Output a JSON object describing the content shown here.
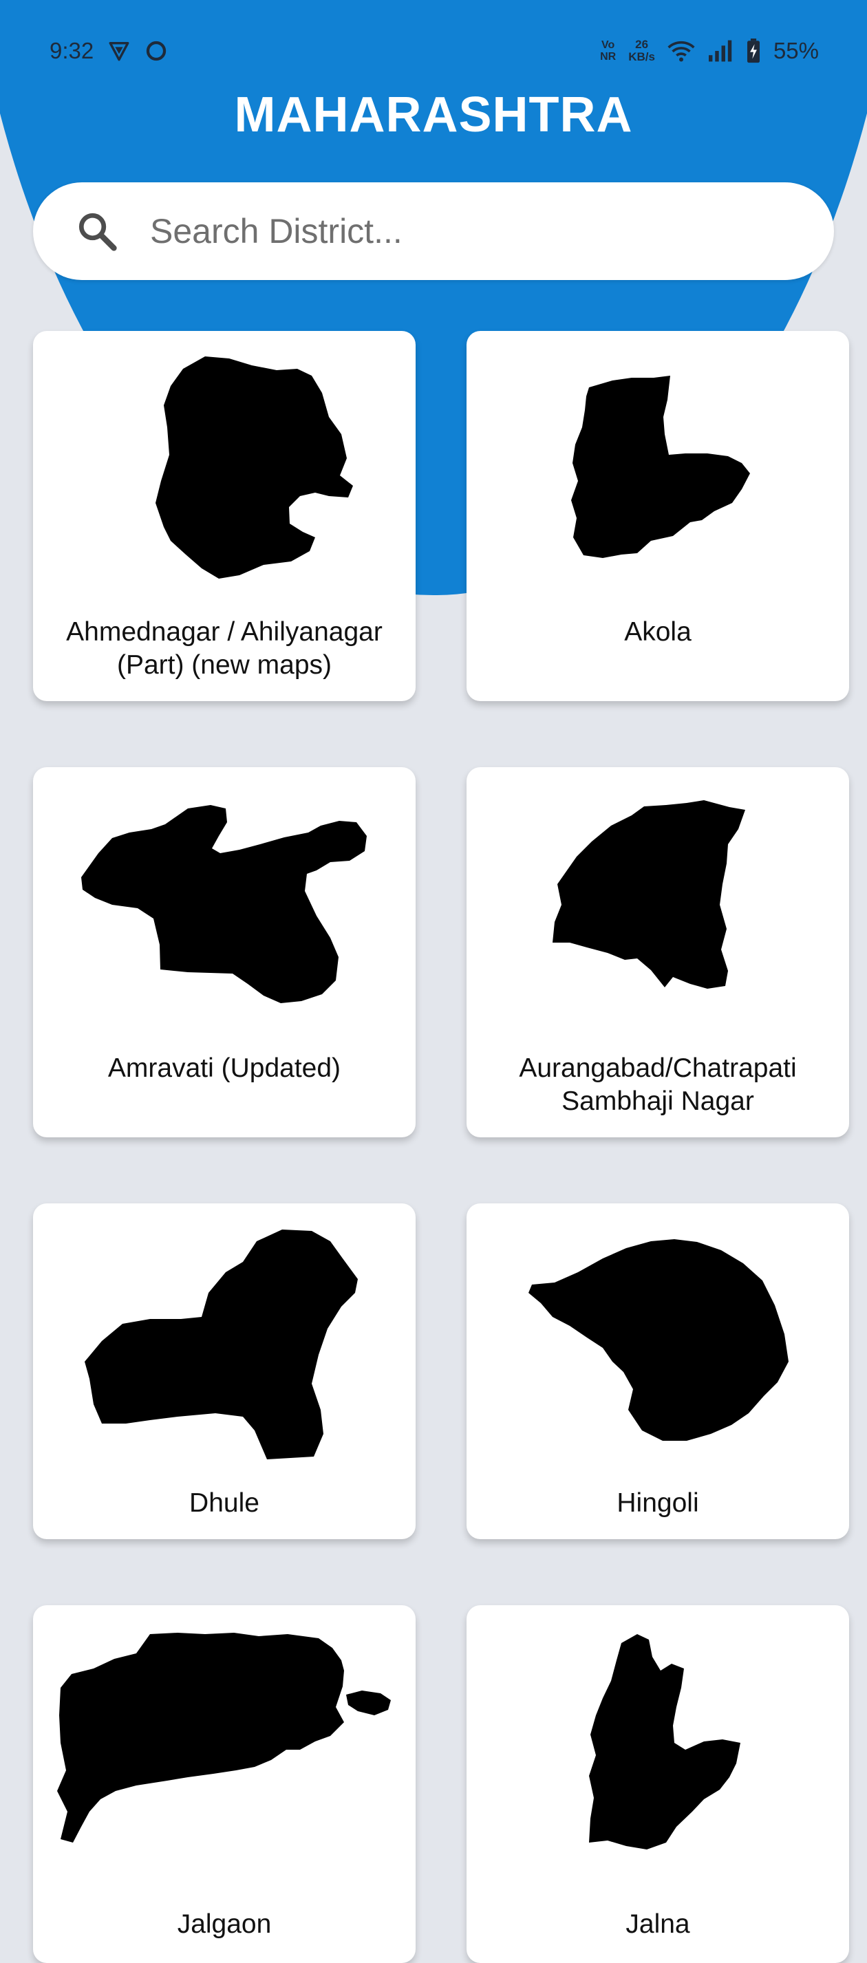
{
  "status_bar": {
    "time": "9:32",
    "volte_top": "Vo",
    "volte_bottom": "NR",
    "speed_value": "26",
    "speed_unit": "KB/s",
    "battery": "55%"
  },
  "app": {
    "title": "MAHARASHTRA"
  },
  "search": {
    "placeholder": "Search District..."
  },
  "districts": [
    {
      "name": "Ahmednagar / Ahilyanagar (Part) (new maps)"
    },
    {
      "name": "Akola"
    },
    {
      "name": "Amravati (Updated)"
    },
    {
      "name": "Aurangabad/Chatrapati Sambhaji Nagar"
    },
    {
      "name": "Dhule"
    },
    {
      "name": "Hingoli"
    },
    {
      "name": "Jalgaon"
    },
    {
      "name": "Jalna"
    }
  ],
  "colors": {
    "header": "#1181d3",
    "background": "#e3e6ec",
    "card": "#ffffff"
  }
}
